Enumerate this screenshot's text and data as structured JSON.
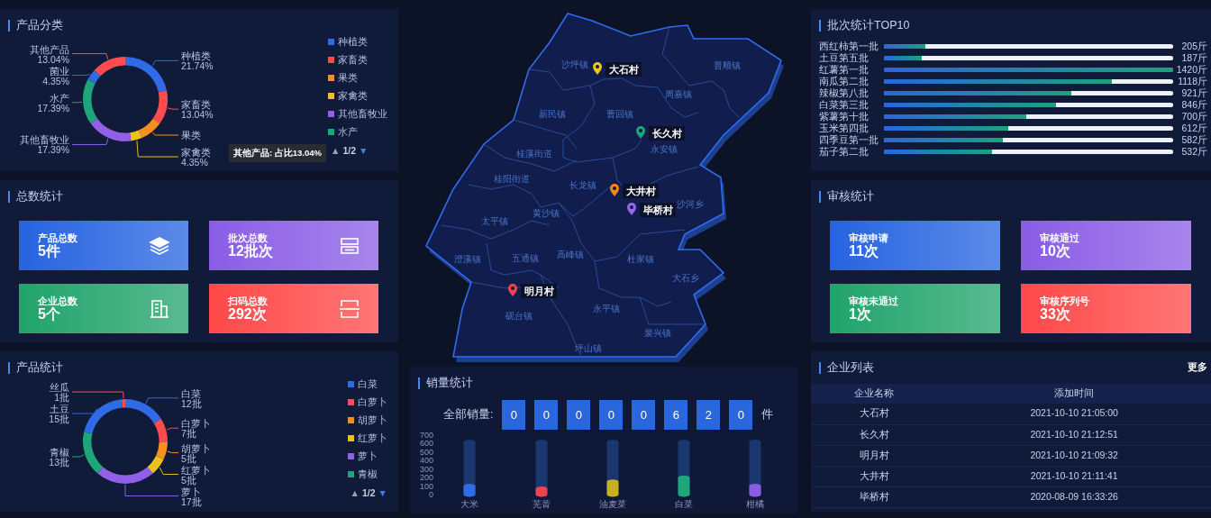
{
  "product_category": {
    "title": "产品分类",
    "chart_data": {
      "type": "donut",
      "categories": [
        "种植类",
        "家畜类",
        "果类",
        "家禽类",
        "其他畜牧业",
        "水产",
        "菌业",
        "其他产品"
      ],
      "values": [
        21.74,
        13.04,
        8.7,
        4.35,
        17.39,
        17.39,
        4.35,
        13.04
      ],
      "value_labels": [
        "21.74%",
        "13.04%",
        null,
        "4.35%",
        "17.39%",
        "17.39%",
        "4.35%",
        "13.04%"
      ],
      "colors": [
        "#2f6be6",
        "#ff4d4f",
        "#f5901e",
        "#e8c31c",
        "#9260e6",
        "#1fa57a",
        "#2f6be6",
        "#ff4d4f"
      ]
    },
    "tooltip": "其他产品: 占比13.04%",
    "legend": {
      "items": [
        {
          "label": "种植类",
          "color": "#2f6be6"
        },
        {
          "label": "家畜类",
          "color": "#ff4d4f"
        },
        {
          "label": "果类",
          "color": "#f5901e"
        },
        {
          "label": "家禽类",
          "color": "#e8c31c"
        },
        {
          "label": "其他畜牧业",
          "color": "#9260e6"
        },
        {
          "label": "水产",
          "color": "#1fa57a"
        }
      ],
      "pager": {
        "prev": "▲",
        "page": "1/2",
        "next": "▼",
        "prev_disabled": true,
        "next_disabled": false
      }
    }
  },
  "total_stats": {
    "title": "总数统计",
    "cards": [
      {
        "label": "产品总数",
        "value": "5件",
        "kind": "layers",
        "color": "#2563e0"
      },
      {
        "label": "批次总数",
        "value": "12批次",
        "kind": "tray",
        "color": "#8a5ce6"
      },
      {
        "label": "企业总数",
        "value": "5个",
        "kind": "building",
        "color": "#20a36b"
      },
      {
        "label": "扫码总数",
        "value": "292次",
        "kind": "scan",
        "color": "#ff4848"
      }
    ]
  },
  "product_stats": {
    "title": "产品统计",
    "chart_data": {
      "type": "donut",
      "categories": [
        "白菜",
        "白萝卜",
        "胡萝卜",
        "红萝卜",
        "萝卜",
        "青椒",
        "土豆",
        "丝瓜"
      ],
      "values": [
        12,
        7,
        5,
        5,
        17,
        13,
        15,
        1
      ],
      "value_labels": [
        "12批",
        "7批",
        "5批",
        "5批",
        "17批",
        "13批",
        "15批",
        "1批"
      ],
      "colors": [
        "#2f6be6",
        "#ff4d4f",
        "#f5901e",
        "#e8c31c",
        "#9260e6",
        "#1fa57a",
        "#2f6be6",
        "#ff4d4f"
      ]
    },
    "legend": {
      "items": [
        {
          "label": "白菜",
          "color": "#2f6be6"
        },
        {
          "label": "白萝卜",
          "color": "#ff4d4f"
        },
        {
          "label": "胡萝卜",
          "color": "#f5901e"
        },
        {
          "label": "红萝卜",
          "color": "#e8c31c"
        },
        {
          "label": "萝卜",
          "color": "#9260e6"
        },
        {
          "label": "青椒",
          "color": "#1fa57a"
        }
      ],
      "pager": {
        "prev": "▲",
        "page": "1/2",
        "next": "▼",
        "prev_disabled": true,
        "next_disabled": false
      }
    }
  },
  "map": {
    "regions": [
      "沙坪镇",
      "普顺镇",
      "周嘉镇",
      "新民镇",
      "曹回镇",
      "永安镇",
      "桂溪街道",
      "桂阳街道",
      "长龙镇",
      "黄沙镇",
      "太平镇",
      "沙河乡",
      "澄溪镇",
      "五通镇",
      "高峰镇",
      "杜家镇",
      "大石乡",
      "砚台镇",
      "永平镇",
      "裴兴镇",
      "坪山镇"
    ],
    "markers": [
      {
        "label": "大石村",
        "color": "#f2c416"
      },
      {
        "label": "长久村",
        "color": "#1fa57a"
      },
      {
        "label": "大井村",
        "color": "#f5861e"
      },
      {
        "label": "毕桥村",
        "color": "#9a63f0"
      },
      {
        "label": "明月村",
        "color": "#ff4050"
      }
    ]
  },
  "sales": {
    "title": "销量统计",
    "total_label": "全部销量:",
    "digits": [
      "0",
      "0",
      "0",
      "0",
      "0",
      "6",
      "2",
      "0"
    ],
    "unit": "件",
    "chart_data": {
      "type": "bar",
      "categories": [
        "大米",
        "芜菁",
        "油麦菜",
        "白菜",
        "柑橘"
      ],
      "series": [
        {
          "color": "#285fb4",
          "values": [
            620,
            620,
            620,
            620,
            620
          ]
        },
        {
          "values": [
            100,
            70,
            150,
            200,
            100
          ],
          "colors": [
            "#2f6be6",
            "#e8454f",
            "#c9ad22",
            "#1fa57a",
            "#8a5ce6"
          ]
        }
      ],
      "ylim": [
        0,
        700
      ],
      "yticks": [
        0,
        100,
        200,
        300,
        400,
        500,
        600,
        700
      ]
    }
  },
  "batch_top10": {
    "title": "批次统计TOP10",
    "rows": [
      {
        "name": "西红柿第一批",
        "level": 0.144,
        "value": "205斤"
      },
      {
        "name": "土豆第五批",
        "level": 0.132,
        "value": "187斤"
      },
      {
        "name": "红薯第一批",
        "level": 1,
        "value": "1420斤"
      },
      {
        "name": "南瓜第二批",
        "level": 0.787,
        "value": "1118斤"
      },
      {
        "name": "辣椒第八批",
        "level": 0.649,
        "value": "921斤"
      },
      {
        "name": "白菜第三批",
        "level": 0.596,
        "value": "846斤"
      },
      {
        "name": "紫薯第十批",
        "level": 0.493,
        "value": "700斤"
      },
      {
        "name": "玉米第四批",
        "level": 0.431,
        "value": "612斤"
      },
      {
        "name": "四季豆第一批",
        "level": 0.41,
        "value": "582斤"
      },
      {
        "name": "茄子第二批",
        "level": 0.375,
        "value": "532斤"
      }
    ]
  },
  "audit_stats": {
    "title": "审核统计",
    "cards": [
      {
        "label": "审核申请",
        "value": "11次",
        "color": "#2563e0"
      },
      {
        "label": "审核通过",
        "value": "10次",
        "color": "#8a5ce6"
      },
      {
        "label": "审核未通过",
        "value": "1次",
        "color": "#20a36b"
      },
      {
        "label": "审核序列号",
        "value": "33次",
        "color": "#ff4848"
      }
    ]
  },
  "company_list": {
    "title": "企业列表",
    "more": "更多",
    "columns": [
      "企业名称",
      "添加时间"
    ],
    "rows": [
      [
        "大石村",
        "2021-10-10 21:05:00"
      ],
      [
        "长久村",
        "2021-10-10 21:12:51"
      ],
      [
        "明月村",
        "2021-10-10 21:09:32"
      ],
      [
        "大井村",
        "2021-10-10 21:11:41"
      ],
      [
        "毕桥村",
        "2020-08-09 16:33:26"
      ]
    ]
  }
}
